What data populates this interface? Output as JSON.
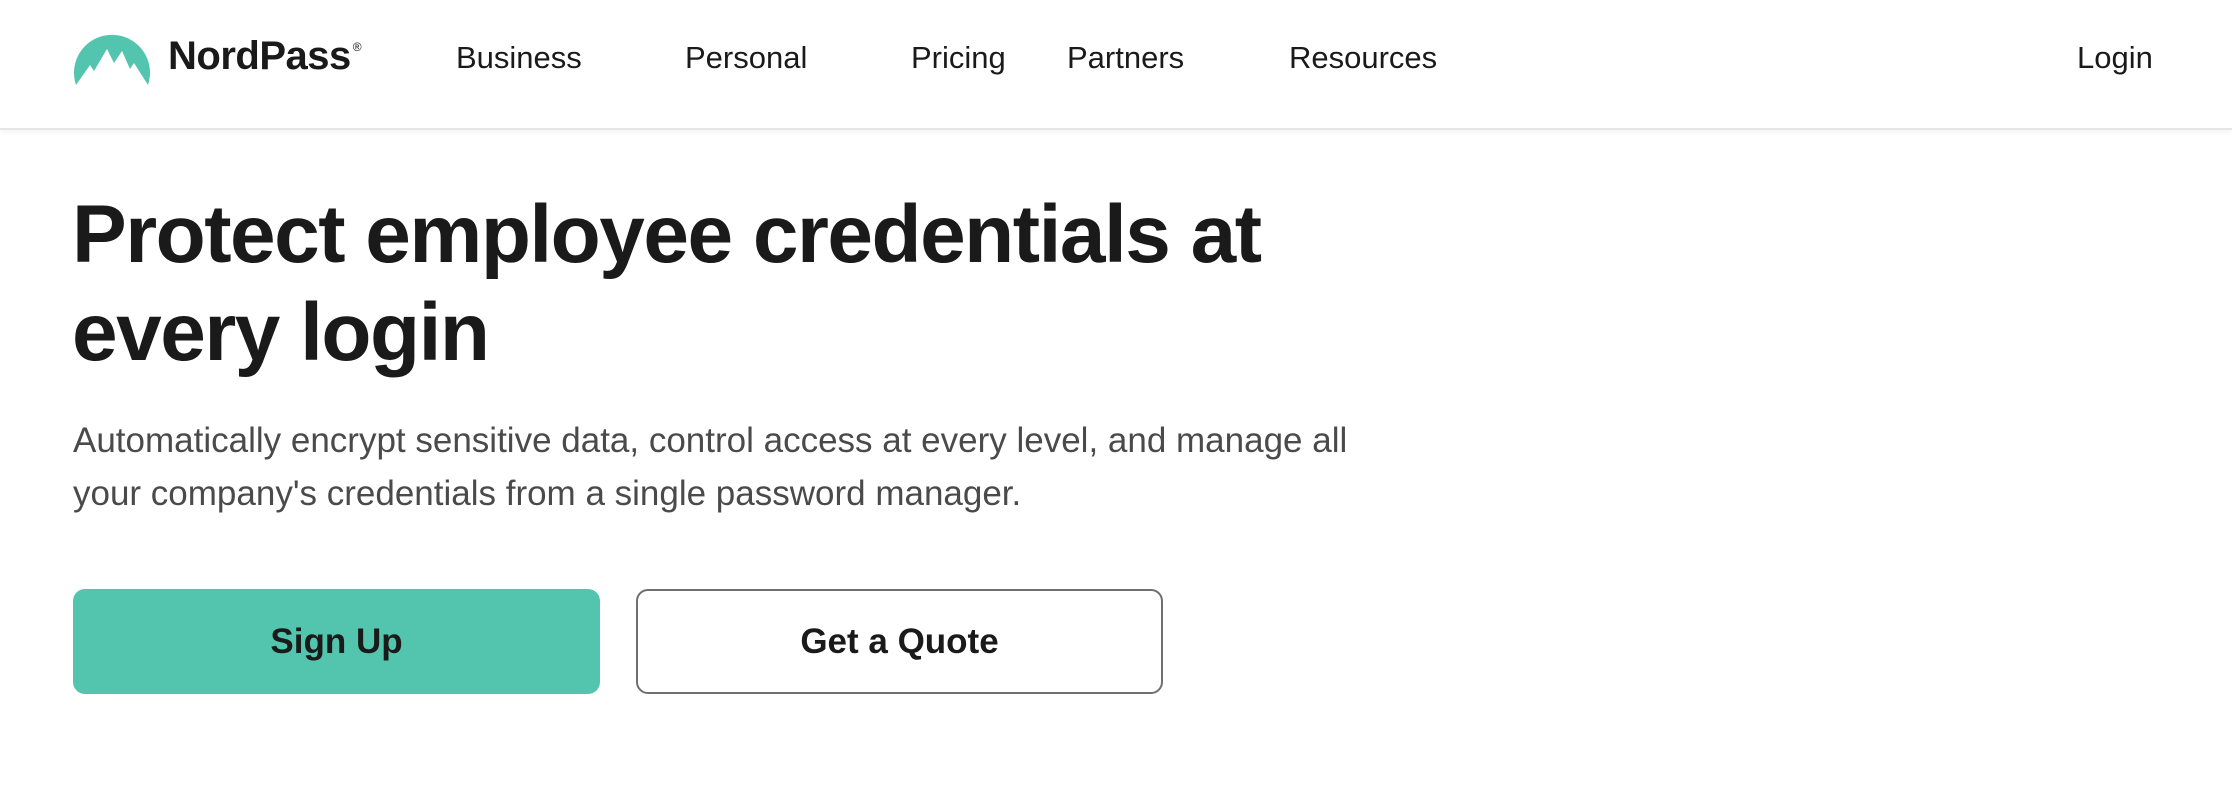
{
  "brand": {
    "name": "NordPass",
    "registered_mark": "®",
    "accent_color": "#53c4ad",
    "logo_icon": "mountain-logo-icon"
  },
  "nav": {
    "items": [
      {
        "label": "Business"
      },
      {
        "label": "Personal"
      },
      {
        "label": "Pricing"
      },
      {
        "label": "Partners"
      },
      {
        "label": "Resources"
      }
    ],
    "login_label": "Login"
  },
  "hero": {
    "title": "Protect employee credentials at every login",
    "subtitle": "Automatically encrypt sensitive data, control access at every level, and manage all your company's credentials from a single password manager.",
    "primary_cta": "Sign Up",
    "secondary_cta": "Get a Quote"
  }
}
